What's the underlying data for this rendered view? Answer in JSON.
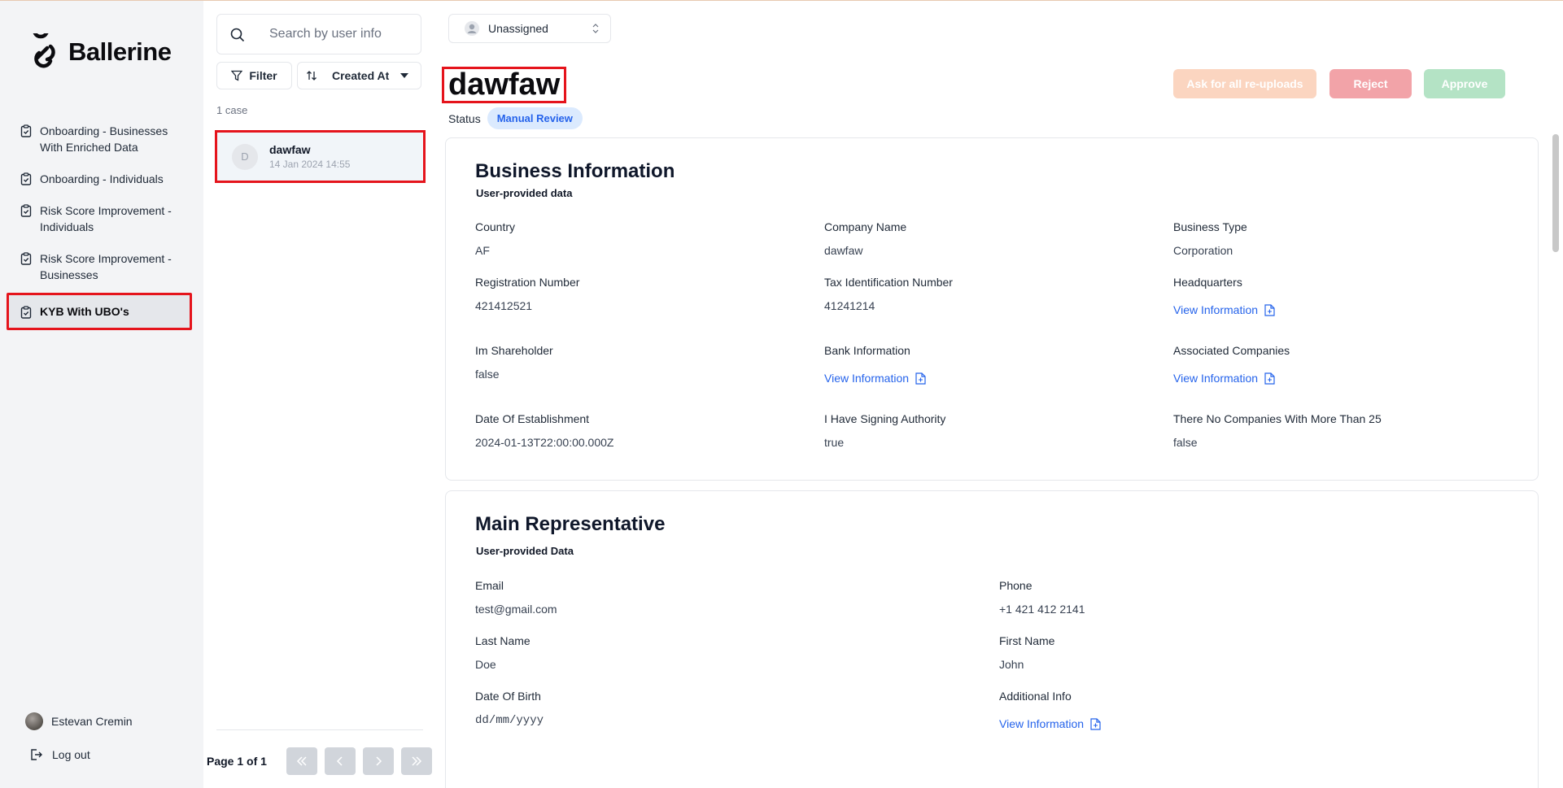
{
  "app": {
    "name": "Ballerine"
  },
  "sidebar": {
    "items": [
      {
        "label": "Onboarding - Businesses With Enriched Data"
      },
      {
        "label": "Onboarding - Individuals"
      },
      {
        "label": "Risk Score Improvement - Individuals"
      },
      {
        "label": "Risk Score Improvement - Businesses"
      },
      {
        "label": "KYB With UBO's",
        "active": true
      }
    ],
    "user_name": "Estevan Cremin",
    "logout_label": "Log out"
  },
  "case_list": {
    "search_placeholder": "Search by user info",
    "filter_label": "Filter",
    "sort_label": "Created At",
    "count_text": "1 case",
    "cases": [
      {
        "initial": "D",
        "name": "dawfaw",
        "date": "14 Jan 2024 14:55"
      }
    ],
    "page_text": "Page 1 of 1"
  },
  "main": {
    "assignee": "Unassigned",
    "title": "dawfaw",
    "status_label": "Status",
    "status_value": "Manual Review",
    "actions": {
      "reupload": "Ask for all re-uploads",
      "reject": "Reject",
      "approve": "Approve"
    },
    "colors": {
      "reupload": "#fbd5c0",
      "reject": "#f2a3a8",
      "approve": "#b4e3c5",
      "link": "#2563eb",
      "badge": "#dbeafe"
    },
    "business": {
      "title": "Business Information",
      "subtitle": "User-provided data",
      "fields": [
        {
          "label": "Country",
          "value": "AF"
        },
        {
          "label": "Company Name",
          "value": "dawfaw"
        },
        {
          "label": "Business Type",
          "value": "Corporation"
        },
        {
          "label": "Registration Number",
          "value": "421412521"
        },
        {
          "label": "Tax Identification Number",
          "value": "41241214"
        },
        {
          "label": "Headquarters",
          "link": "View Information"
        },
        {
          "label": "Im Shareholder",
          "value": "false"
        },
        {
          "label": "Bank Information",
          "link": "View Information"
        },
        {
          "label": "Associated Companies",
          "link": "View Information"
        },
        {
          "label": "Date Of Establishment",
          "value": "2024-01-13T22:00:00.000Z"
        },
        {
          "label": "I Have Signing Authority",
          "value": "true"
        },
        {
          "label": "There No Companies With More Than 25",
          "value": "false"
        }
      ]
    },
    "representative": {
      "title": "Main Representative",
      "subtitle": "User-provided Data",
      "fields": [
        {
          "label": "Email",
          "value": "test@gmail.com"
        },
        {
          "label": "Phone",
          "value": "+1 421 412 2141"
        },
        {
          "label": "Last Name",
          "value": "Doe"
        },
        {
          "label": "First Name",
          "value": "John"
        },
        {
          "label": "Date Of Birth",
          "value": "dd/mm/yyyy"
        },
        {
          "label": "Additional Info",
          "link": "View Information"
        }
      ]
    }
  }
}
